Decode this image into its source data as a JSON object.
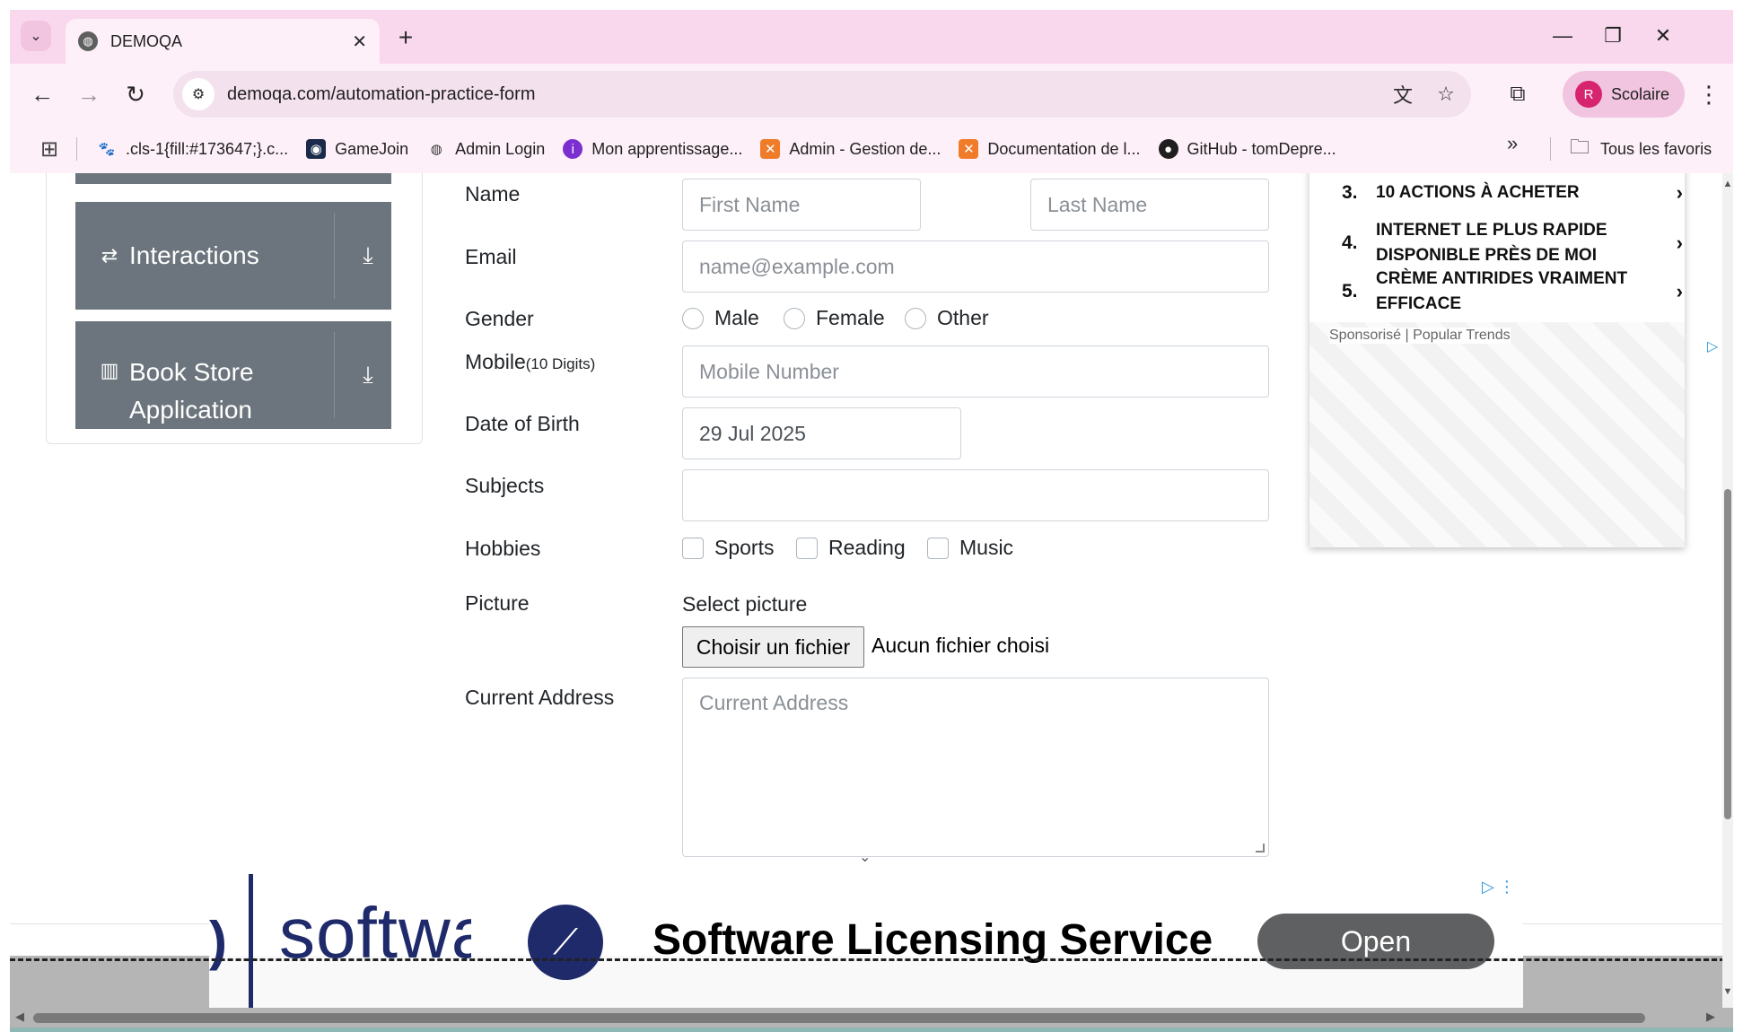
{
  "browser": {
    "tab_title": "DEMOQA",
    "url": "demoqa.com/automation-practice-form",
    "profile_initial": "R",
    "profile_label": "Scolaire",
    "bookmarks": [
      {
        "label": ".cls-1{fill:#173647;}.c...",
        "icon": "cat-icon"
      },
      {
        "label": "GameJoin",
        "icon": "gamejoin-icon"
      },
      {
        "label": "Admin Login",
        "icon": "globe-icon"
      },
      {
        "label": "Mon apprentissage...",
        "icon": "learning-icon"
      },
      {
        "label": "Admin - Gestion de...",
        "icon": "xampp-icon"
      },
      {
        "label": "Documentation de l...",
        "icon": "xampp-icon"
      },
      {
        "label": "GitHub - tomDepre...",
        "icon": "github-icon"
      }
    ],
    "all_bookmarks_label": "Tous les favoris"
  },
  "sidebar": {
    "groups": [
      {
        "label": "Interactions",
        "icon": "interactions-icon"
      },
      {
        "label": "Book Store Application",
        "icon": "book-icon"
      }
    ]
  },
  "form": {
    "name_label": "Name",
    "first_name_placeholder": "First Name",
    "last_name_placeholder": "Last Name",
    "email_label": "Email",
    "email_placeholder": "name@example.com",
    "gender_label": "Gender",
    "gender_options": [
      "Male",
      "Female",
      "Other"
    ],
    "mobile_label": "Mobile",
    "mobile_hint": "(10 Digits)",
    "mobile_placeholder": "Mobile Number",
    "dob_label": "Date of Birth",
    "dob_value": "29 Jul 2025",
    "subjects_label": "Subjects",
    "hobbies_label": "Hobbies",
    "hobby_options": [
      "Sports",
      "Reading",
      "Music"
    ],
    "picture_label": "Picture",
    "select_picture": "Select picture",
    "file_button": "Choisir un fichier",
    "file_status": "Aucun fichier choisi",
    "address_label": "Current Address",
    "address_placeholder": "Current Address"
  },
  "ad_trends": {
    "items": [
      {
        "num": "3.",
        "text": "10 ACTIONS À ACHETER"
      },
      {
        "num": "4.",
        "text": "INTERNET LE PLUS RAPIDE DISPONIBLE PRÈS DE MOI"
      },
      {
        "num": "5.",
        "text": "CRÈME ANTIRIDES VRAIMENT EFFICACE"
      }
    ],
    "sponsor_text": "Sponsorisé | Popular Trends"
  },
  "ad_bottom": {
    "brand_text": "softwa",
    "headline": "Software Licensing Service",
    "cta": "Open"
  },
  "colors": {
    "chrome_bg": "#f9d8ee",
    "sidebar_group": "#6c757d",
    "ad_navy": "#1f2a6b",
    "profile_avatar": "#d6246e"
  }
}
